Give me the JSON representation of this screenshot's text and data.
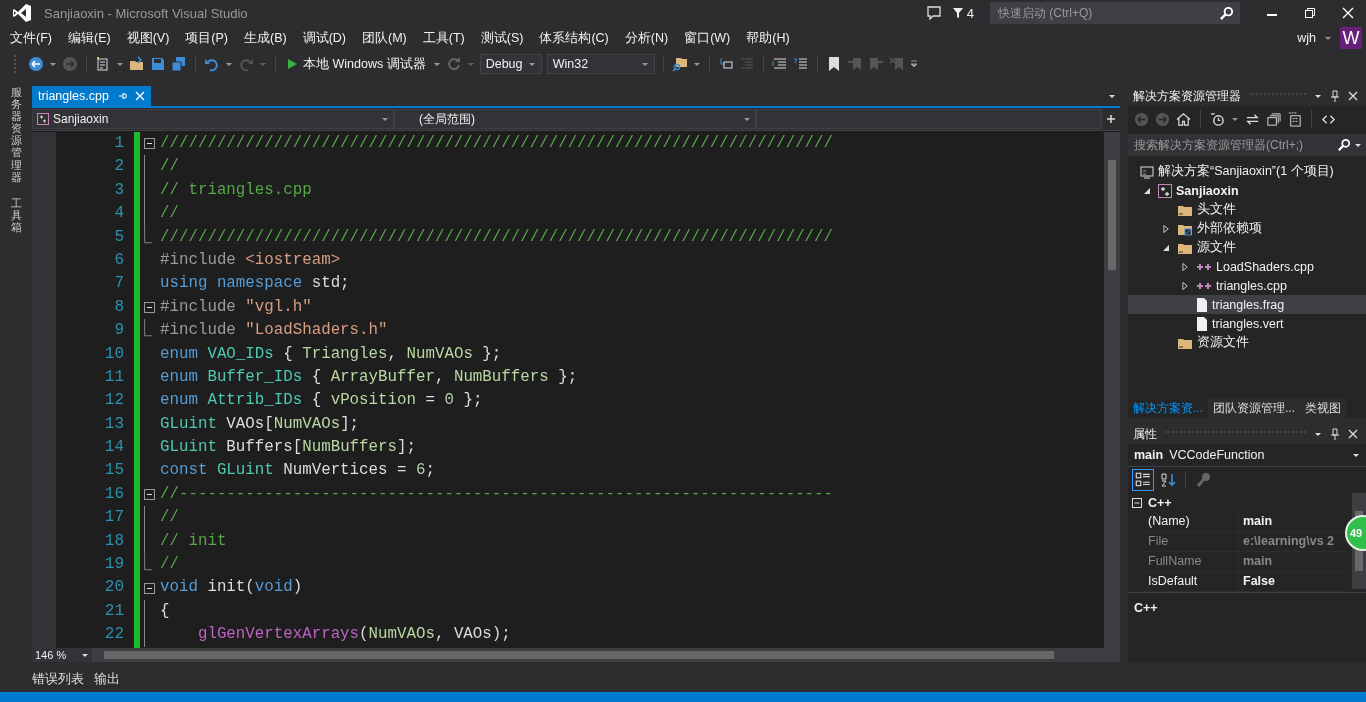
{
  "window": {
    "title": "Sanjiaoxin - Microsoft Visual Studio",
    "notification_count": "4",
    "quick_launch": {
      "placeholder": "快速启动 (Ctrl+Q)"
    },
    "user": "wjh",
    "avatar_initial": "W"
  },
  "menu": [
    "文件(F)",
    "编辑(E)",
    "视图(V)",
    "项目(P)",
    "生成(B)",
    "调试(D)",
    "团队(M)",
    "工具(T)",
    "测试(S)",
    "体系结构(C)",
    "分析(N)",
    "窗口(W)",
    "帮助(H)"
  ],
  "toolbar": {
    "debugger": "本地 Windows 调试器",
    "configuration": "Debug",
    "platform": "Win32"
  },
  "side_tabs": [
    "服务器资源管理器",
    "工具箱"
  ],
  "editor": {
    "tabs": [
      {
        "label": "triangles.cpp",
        "selected": true
      }
    ],
    "project_scope": "Sanjiaoxin",
    "function_scope": "(全局范围)",
    "zoom": "146 %",
    "lines": [
      {
        "number": "1",
        "kind": "fold_start",
        "tokens": [
          {
            "kind": "comment",
            "text": "///////////////////////////////////////////////////////////////////////"
          }
        ]
      },
      {
        "number": "2",
        "kind": "fold_inside",
        "tokens": [
          {
            "kind": "comment",
            "text": "//"
          }
        ]
      },
      {
        "number": "3",
        "kind": "fold_inside",
        "tokens": [
          {
            "kind": "comment",
            "text": "// triangles.cpp"
          }
        ]
      },
      {
        "number": "4",
        "kind": "fold_inside",
        "tokens": [
          {
            "kind": "comment",
            "text": "//"
          }
        ]
      },
      {
        "number": "5",
        "kind": "fold_end",
        "tokens": [
          {
            "kind": "comment",
            "text": "///////////////////////////////////////////////////////////////////////"
          }
        ]
      },
      {
        "number": "6",
        "kind": "code",
        "tokens": [
          {
            "kind": "preprocessor",
            "text": "#include"
          },
          {
            "kind": "string",
            "text": " <iostream>"
          }
        ]
      },
      {
        "number": "7",
        "kind": "code",
        "tokens": [
          {
            "kind": "keyword",
            "text": "using namespace"
          },
          {
            "kind": "plain",
            "text": " std;"
          }
        ]
      },
      {
        "number": "8",
        "kind": "fold_start",
        "tokens": [
          {
            "kind": "preprocessor",
            "text": "#include"
          },
          {
            "kind": "string",
            "text": " \"vgl.h\""
          }
        ]
      },
      {
        "number": "9",
        "kind": "fold_end",
        "tokens": [
          {
            "kind": "preprocessor",
            "text": "#include"
          },
          {
            "kind": "string",
            "text": " \"LoadShaders.h\""
          }
        ]
      },
      {
        "number": "10",
        "kind": "code",
        "tokens": [
          {
            "kind": "keyword",
            "text": "enum"
          },
          {
            "kind": "type",
            "text": " VAO_IDs"
          },
          {
            "kind": "plain",
            "text": " { "
          },
          {
            "kind": "enum",
            "text": "Triangles"
          },
          {
            "kind": "plain",
            "text": ", "
          },
          {
            "kind": "enum",
            "text": "NumVAOs"
          },
          {
            "kind": "plain",
            "text": " };"
          }
        ]
      },
      {
        "number": "11",
        "kind": "code",
        "tokens": [
          {
            "kind": "keyword",
            "text": "enum"
          },
          {
            "kind": "type",
            "text": " Buffer_IDs"
          },
          {
            "kind": "plain",
            "text": " { "
          },
          {
            "kind": "enum",
            "text": "ArrayBuffer"
          },
          {
            "kind": "plain",
            "text": ", "
          },
          {
            "kind": "enum",
            "text": "NumBuffers"
          },
          {
            "kind": "plain",
            "text": " };"
          }
        ]
      },
      {
        "number": "12",
        "kind": "code",
        "tokens": [
          {
            "kind": "keyword",
            "text": "enum"
          },
          {
            "kind": "type",
            "text": " Attrib_IDs"
          },
          {
            "kind": "plain",
            "text": " { "
          },
          {
            "kind": "enum",
            "text": "vPosition"
          },
          {
            "kind": "plain",
            "text": " = "
          },
          {
            "kind": "number",
            "text": "0"
          },
          {
            "kind": "plain",
            "text": " };"
          }
        ]
      },
      {
        "number": "13",
        "kind": "code",
        "tokens": [
          {
            "kind": "type",
            "text": "GLuint"
          },
          {
            "kind": "plain",
            "text": " VAOs["
          },
          {
            "kind": "enum",
            "text": "NumVAOs"
          },
          {
            "kind": "plain",
            "text": "];"
          }
        ]
      },
      {
        "number": "14",
        "kind": "code",
        "tokens": [
          {
            "kind": "type",
            "text": "GLuint"
          },
          {
            "kind": "plain",
            "text": " Buffers["
          },
          {
            "kind": "enum",
            "text": "NumBuffers"
          },
          {
            "kind": "plain",
            "text": "];"
          }
        ]
      },
      {
        "number": "15",
        "kind": "code",
        "tokens": [
          {
            "kind": "keyword",
            "text": "const"
          },
          {
            "kind": "type",
            "text": " GLuint"
          },
          {
            "kind": "plain",
            "text": " NumVertices = "
          },
          {
            "kind": "number",
            "text": "6"
          },
          {
            "kind": "plain",
            "text": ";"
          }
        ]
      },
      {
        "number": "16",
        "kind": "fold_start",
        "tokens": [
          {
            "kind": "comment",
            "text": "//---------------------------------------------------------------------"
          }
        ]
      },
      {
        "number": "17",
        "kind": "fold_inside",
        "tokens": [
          {
            "kind": "comment",
            "text": "//"
          }
        ]
      },
      {
        "number": "18",
        "kind": "fold_inside",
        "tokens": [
          {
            "kind": "comment",
            "text": "// init"
          }
        ]
      },
      {
        "number": "19",
        "kind": "fold_end",
        "tokens": [
          {
            "kind": "comment",
            "text": "//"
          }
        ]
      },
      {
        "number": "20",
        "kind": "fold_start",
        "tokens": [
          {
            "kind": "keyword",
            "text": "void"
          },
          {
            "kind": "plain",
            "text": " init("
          },
          {
            "kind": "keyword",
            "text": "void"
          },
          {
            "kind": "plain",
            "text": ")"
          }
        ]
      },
      {
        "number": "21",
        "kind": "fold_inside",
        "tokens": [
          {
            "kind": "plain",
            "text": "{"
          }
        ]
      },
      {
        "number": "22",
        "kind": "fold_inside",
        "tokens": [
          {
            "kind": "macro",
            "text": "    glGenVertexArrays"
          },
          {
            "kind": "plain",
            "text": "("
          },
          {
            "kind": "enum",
            "text": "NumVAOs"
          },
          {
            "kind": "plain",
            "text": ", VAOs);"
          }
        ]
      }
    ]
  },
  "solution_explorer": {
    "title": "解决方案资源管理器",
    "search": {
      "placeholder": "搜索解决方案资源管理器(Ctrl+;)"
    },
    "tree": [
      {
        "label": "解决方案“Sanjiaoxin”(1 个项目)",
        "kind": "solution",
        "selected": false,
        "children": [
          {
            "label": "Sanjiaoxin",
            "kind": "project",
            "expanded": true,
            "selected": false,
            "children": [
              {
                "label": "头文件",
                "kind": "folder",
                "selected": false
              },
              {
                "label": "外部依赖项",
                "kind": "reference",
                "expanded": false,
                "selected": false
              },
              {
                "label": "源文件",
                "kind": "folder",
                "expanded": true,
                "selected": false,
                "children": [
                  {
                    "label": "LoadShaders.cpp",
                    "kind": "cpp",
                    "expanded": false,
                    "selected": false
                  },
                  {
                    "label": "triangles.cpp",
                    "kind": "cpp",
                    "expanded": false,
                    "selected": false
                  },
                  {
                    "label": "triangles.frag",
                    "kind": "file",
                    "selected": true
                  },
                  {
                    "label": "triangles.vert",
                    "kind": "file",
                    "selected": false
                  }
                ]
              },
              {
                "label": "资源文件",
                "kind": "folder",
                "selected": false
              }
            ]
          }
        ]
      }
    ],
    "tabs": [
      {
        "label": "解决方案资...",
        "selected": true
      },
      {
        "label": "团队资源管理...",
        "selected": false
      },
      {
        "label": "类视图",
        "selected": false
      }
    ]
  },
  "properties": {
    "title": "属性",
    "object_name": "main",
    "object_type": "VCCodeFunction",
    "category": "C++",
    "rows": [
      {
        "name": "(Name)",
        "value": "main",
        "dimmed": false
      },
      {
        "name": "File",
        "value": "e:\\learning\\vs 2",
        "dimmed": true
      },
      {
        "name": "FullName",
        "value": "main",
        "dimmed": true
      },
      {
        "name": "IsDefault",
        "value": "False",
        "dimmed": false
      }
    ],
    "description": "C++"
  },
  "floating_badge": "49",
  "bottom_tabs": [
    "错误列表",
    "输出"
  ]
}
